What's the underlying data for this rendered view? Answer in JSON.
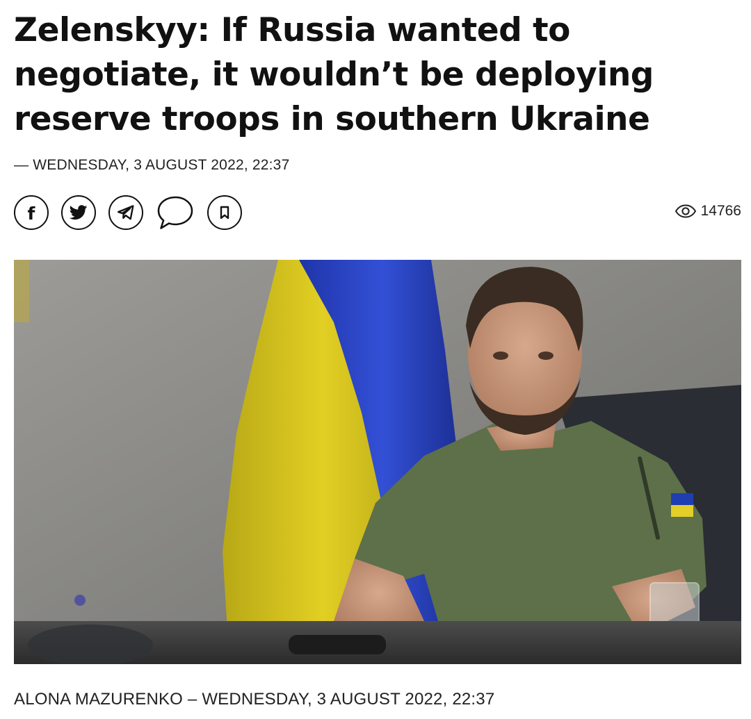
{
  "article": {
    "headline": "Zelenskyy: If Russia wanted to negotiate, it wouldn’t be deploying reserve troops in southern Ukraine",
    "dateline": "— WEDNESDAY, 3 AUGUST 2022, 22:37",
    "byline": "ALONA MAZURENKO – WEDNESDAY, 3 AUGUST 2022, 22:37"
  },
  "share": {
    "facebook_glyph": "f",
    "items": [
      "facebook-icon",
      "twitter-icon",
      "telegram-icon",
      "comment-icon",
      "bookmark-icon"
    ]
  },
  "stats": {
    "views": "14766",
    "views_icon": "eye-icon"
  },
  "colors": {
    "flag_blue": "#2b44c8",
    "flag_yellow": "#d8c51a",
    "shirt_green": "#5d7049"
  }
}
